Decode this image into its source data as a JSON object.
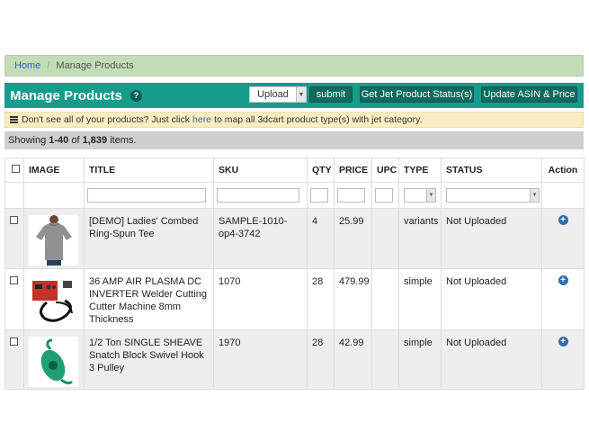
{
  "breadcrumb": {
    "home": "Home",
    "separator": "/",
    "current": "Manage Products"
  },
  "header": {
    "title": "Manage Products",
    "help": "?",
    "upload_select": "Upload",
    "submit_label": "submit",
    "jet_status_label": "Get Jet Product Status(s)",
    "update_label": "Update ASIN & Price"
  },
  "info": {
    "prefix": "Don't see all of your products? Just click",
    "link": "here",
    "suffix": "to map all 3dcart product type(s) with jet category."
  },
  "showing": {
    "prefix": "Showing",
    "range": "1-40",
    "of": "of",
    "total": "1,839",
    "suffix": "items."
  },
  "table": {
    "headers": {
      "image": "IMAGE",
      "title": "TITLE",
      "sku": "SKU",
      "qty": "QTY",
      "price": "PRICE",
      "upc": "UPC",
      "type": "TYPE",
      "status": "STATUS",
      "action": "Action"
    },
    "rows": [
      {
        "title": "[DEMO] Ladies' Combed Ring-Spun Tee",
        "sku": "SAMPLE-1010-op4-3742",
        "qty": "4",
        "price": "25.99",
        "upc": "",
        "type": "variants",
        "status": "Not Uploaded",
        "image_icon": "tshirt-photo"
      },
      {
        "title": "36 AMP AIR PLASMA DC INVERTER Welder Cutting Cutter Machine 8mm Thickness",
        "sku": "1070",
        "qty": "28",
        "price": "479.99",
        "upc": "",
        "type": "simple",
        "status": "Not Uploaded",
        "image_icon": "welder-photo"
      },
      {
        "title": "1/2 Ton SINGLE SHEAVE Snatch Block Swivel Hook 3 Pulley",
        "sku": "1970",
        "qty": "28",
        "price": "42.99",
        "upc": "",
        "type": "simple",
        "status": "Not Uploaded",
        "image_icon": "pulley-photo"
      }
    ]
  },
  "colors": {
    "header_bg": "#179b8a",
    "button_bg": "#0e6b5e",
    "breadcrumb_bg": "#c3dcb6",
    "info_bg": "#f8ecc2",
    "action_icon": "#2f6fb0"
  }
}
